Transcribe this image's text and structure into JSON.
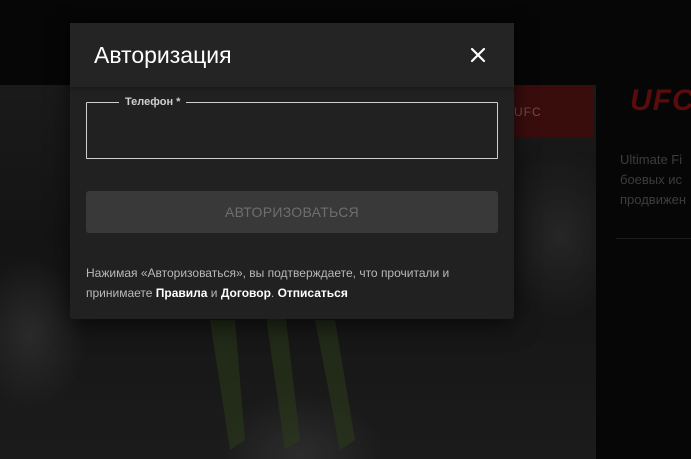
{
  "background": {
    "ufc_strip_text": "UFC",
    "ufc_logo_text": "UFC",
    "side_text_lines": [
      "Ultimate Fi",
      "боевых ис",
      "продвижен"
    ]
  },
  "modal": {
    "title": "Авторизация",
    "close_icon": "close-icon",
    "phone_field": {
      "label": "Телефон *",
      "value": ""
    },
    "submit_label": "АВТОРИЗОВАТЬСЯ",
    "terms": {
      "text_part1": "Нажимая «Авторизоваться», вы подтверждаете, что прочитали и принимаете ",
      "rules_link": "Правила",
      "conjunction": " и ",
      "agreement_link": "Договор",
      "separator": ". ",
      "unsubscribe_link": "Отписаться"
    }
  },
  "colors": {
    "modal_bg": "#212121",
    "button_bg": "#393939",
    "button_text": "#6e6e6e",
    "overlay_bg": "#000000"
  }
}
